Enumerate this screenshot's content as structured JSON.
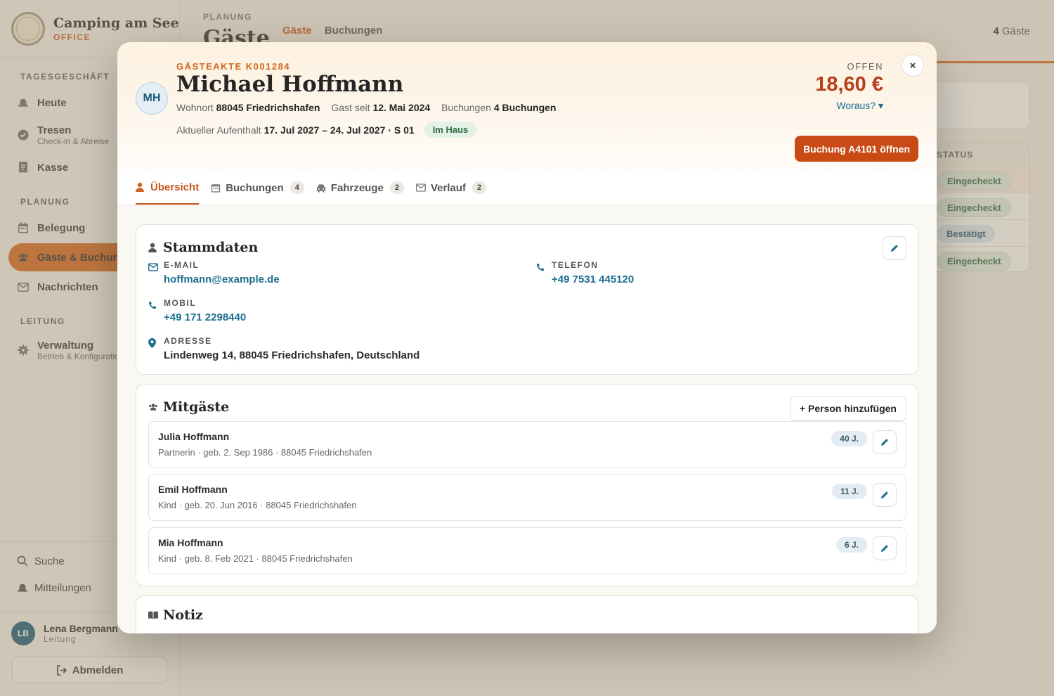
{
  "brand": {
    "name": "Camping am See",
    "sub": "OFFICE"
  },
  "sidebar": {
    "sections": [
      {
        "title": "TAGESGESCHÄFT"
      },
      {
        "title": "PLANUNG"
      },
      {
        "title": "LEITUNG"
      }
    ],
    "items": [
      {
        "label": "Heute",
        "icon": "bell-icon"
      },
      {
        "label": "Tresen",
        "sub": "Check-in & Abreise",
        "icon": "check-circle-icon"
      },
      {
        "label": "Kasse",
        "icon": "receipt-icon"
      },
      {
        "label": "Belegung",
        "icon": "calendar-icon"
      },
      {
        "label": "Gäste & Buchung",
        "icon": "users-icon",
        "active": true
      },
      {
        "label": "Nachrichten",
        "icon": "mail-icon"
      },
      {
        "label": "Verwaltung",
        "sub": "Betrieb & Konfiguration",
        "icon": "gear-icon"
      }
    ],
    "utilities": [
      {
        "label": "Suche",
        "icon": "search-icon"
      },
      {
        "label": "Mitteilungen",
        "icon": "bell-icon"
      }
    ],
    "user": {
      "initials": "LB",
      "name": "Lena Bergmann",
      "role": "Leitung"
    },
    "logout_label": "Abmelden"
  },
  "main": {
    "eyebrow": "PLANUNG",
    "title": "Gäste",
    "tabs": [
      {
        "label": "Gäste",
        "active": true
      },
      {
        "label": "Buchungen"
      }
    ],
    "count_num": "4",
    "count_label": "Gäste",
    "table_header": "STATUS",
    "statuses": [
      "Eingecheckt",
      "Eingecheckt",
      "Bestätigt",
      "Eingecheckt"
    ]
  },
  "modal": {
    "file_id": "GÄSTEAKTE K001284",
    "initials": "MH",
    "name": "Michael Hoffmann",
    "meta": {
      "wohnort_label": "Wohnort",
      "wohnort": "88045 Friedrichshafen",
      "gast_seit_label": "Gast seit",
      "gast_seit": "12. Mai 2024",
      "buchungen_label": "Buchungen",
      "buchungen": "4 Buchungen",
      "aufenthalt_label": "Aktueller Aufenthalt",
      "aufenthalt": "17. Jul 2027 – 24. Jul 2027 · S 01",
      "status_badge": "Im Haus"
    },
    "open_label": "OFFEN",
    "open_amount": "18,60 €",
    "woraus_label": "Woraus? ▾",
    "close_label": "×",
    "booking_button": "Buchung A4101 öffnen",
    "tabs": [
      {
        "label": "Übersicht",
        "icon": "person-icon",
        "active": true
      },
      {
        "label": "Buchungen",
        "icon": "calendar-icon",
        "count": "4"
      },
      {
        "label": "Fahrzeuge",
        "icon": "car-icon",
        "count": "2"
      },
      {
        "label": "Verlauf",
        "icon": "mail-icon",
        "count": "2"
      }
    ],
    "stammdaten": {
      "title": "Stammdaten",
      "email_label": "E-MAIL",
      "email": "hoffmann@example.de",
      "telefon_label": "TELEFON",
      "telefon": "+49 7531 445120",
      "mobil_label": "MOBIL",
      "mobil": "+49 171 2298440",
      "adresse_label": "ADRESSE",
      "adresse": "Lindenweg 14, 88045 Friedrichshafen, Deutschland"
    },
    "mitgaeste": {
      "title": "Mitgäste",
      "add_label": "+ Person hinzufügen",
      "persons": [
        {
          "name": "Julia Hoffmann",
          "detail": "Partnerin · geb. 2. Sep 1986 · 88045 Friedrichshafen",
          "age": "40 J."
        },
        {
          "name": "Emil Hoffmann",
          "detail": "Kind · geb. 20. Jun 2016 · 88045 Friedrichshafen",
          "age": "11 J."
        },
        {
          "name": "Mia Hoffmann",
          "detail": "Kind · geb. 8. Feb 2021 · 88045 Friedrichshafen",
          "age": "6 J."
        }
      ]
    },
    "notiz": {
      "title": "Notiz"
    }
  },
  "colors": {
    "accent": "#c8581e",
    "primary_button": "#c94a14",
    "link": "#1d6e8f",
    "amount": "#b6401a"
  }
}
